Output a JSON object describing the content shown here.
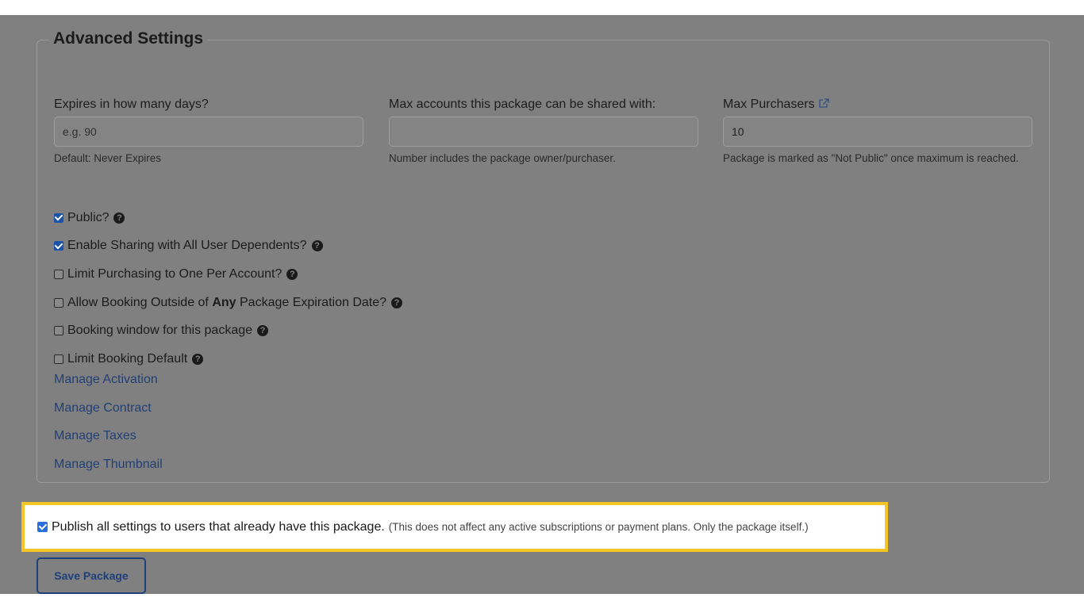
{
  "section": {
    "title": "Advanced Settings"
  },
  "fields": {
    "expires": {
      "label": "Expires in how many days?",
      "value": "",
      "placeholder": "e.g. 90",
      "help": "Default: Never Expires"
    },
    "max_accounts": {
      "label": "Max accounts this package can be shared with:",
      "value": "",
      "placeholder": "",
      "help": "Number includes the package owner/purchaser."
    },
    "max_purchasers": {
      "label": "Max Purchasers",
      "icon": "external-link-icon",
      "value": "10",
      "help": "Package is marked as \"Not Public\" once maximum is reached."
    }
  },
  "checkboxes": [
    {
      "label": "Public?",
      "checked": true,
      "icon": "question-circle-icon"
    },
    {
      "label": "Enable Sharing with All User Dependents?",
      "checked": true,
      "icon": "question-circle-icon"
    },
    {
      "label": "Limit Purchasing to One Per Account?",
      "checked": false,
      "icon": "question-circle-icon"
    },
    {
      "label_before": "Allow Booking Outside of ",
      "label_bold": "Any",
      "label_after": " Package Expiration Date?",
      "checked": false,
      "icon": "question-circle-icon"
    },
    {
      "label": "Booking window for this package",
      "checked": false,
      "icon": "question-circle-icon"
    },
    {
      "label": "Limit Booking Default",
      "checked": false,
      "icon": "question-circle-icon"
    }
  ],
  "links": [
    "Manage Activation",
    "Manage Contract",
    "Manage Taxes",
    "Manage Thumbnail"
  ],
  "publish": {
    "checked": true,
    "label": "Publish all settings to users that already have this package.",
    "note": "(This does not affect any active subscriptions or payment plans. Only the package itself.)"
  },
  "save_button": "Save Package",
  "colors": {
    "overlay": "#808080",
    "link": "#223f75",
    "highlight_border": "#f5c623",
    "checkbox_checked": "#2a6fdb"
  }
}
